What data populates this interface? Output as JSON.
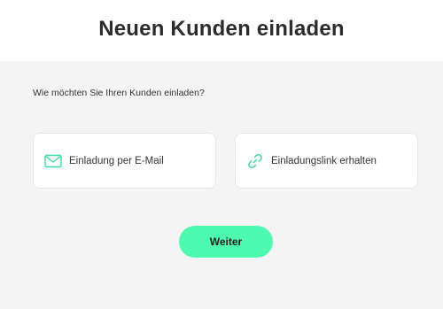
{
  "header": {
    "title": "Neuen Kunden einladen"
  },
  "main": {
    "question": "Wie möchten Sie Ihren Kunden einladen?",
    "options": [
      {
        "label": "Einladung per E-Mail",
        "icon": "mail-icon"
      },
      {
        "label": "Einladungslink erhalten",
        "icon": "link-icon"
      }
    ],
    "next_label": "Weiter"
  },
  "colors": {
    "accent": "#4efab0",
    "icon": "#3fd9a0",
    "panel_bg": "#f4f4f5",
    "text": "#333333"
  }
}
